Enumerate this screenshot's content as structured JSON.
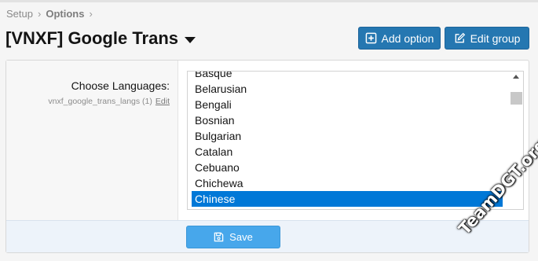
{
  "breadcrumb": {
    "items": [
      "Setup",
      "Options"
    ]
  },
  "page": {
    "title": "[VNXF] Google Trans"
  },
  "header_buttons": {
    "add_option": "Add option",
    "edit_group": "Edit group"
  },
  "option": {
    "label": "Choose Languages:",
    "hint": "vnxf_google_trans_langs (1)",
    "edit_link": "Edit",
    "languages": [
      "Basque",
      "Belarusian",
      "Bengali",
      "Bosnian",
      "Bulgarian",
      "Catalan",
      "Cebuano",
      "Chichewa",
      "Chinese"
    ],
    "selected": "Chinese"
  },
  "footer": {
    "save_label": "Save"
  },
  "watermark": "TeamDGT.org",
  "colors": {
    "primary_button": "#2577b1",
    "save_button": "#47a7eb",
    "selection": "#0078d7"
  }
}
